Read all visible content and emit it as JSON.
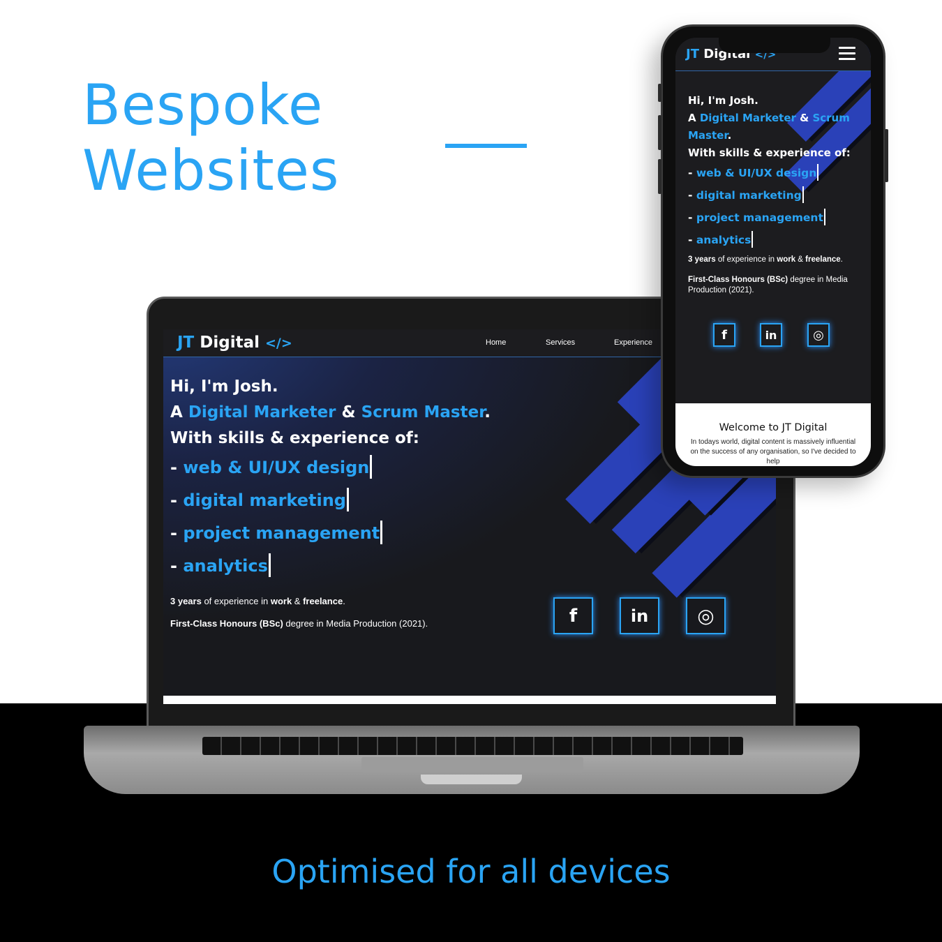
{
  "headline": {
    "line1": "Bespoke",
    "line2": "Websites"
  },
  "tagline": "Optimised for all devices",
  "colors": {
    "accent": "#2aa4f4",
    "stripe": "#2a41b8",
    "dark": "#1c1c1f"
  },
  "site": {
    "logo_prefix": "JT",
    "logo_name": "Digital",
    "logo_code": "</>",
    "nav": [
      "Home",
      "Services",
      "Experience"
    ],
    "hero": {
      "greeting": "Hi, I'm Josh.",
      "role_prefix": "A",
      "role1": "Digital Marketer",
      "role_and": "&",
      "role2": "Scrum Master",
      "role_suffix": ".",
      "skills_heading": "With skills & experience of:",
      "skills": [
        "web & UI/UX design",
        "digital marketing",
        "project management",
        "analytics"
      ]
    },
    "info1": {
      "a": "3 years",
      "b": " of experience in ",
      "c": "work",
      "d": " & ",
      "e": "freelance",
      "f": "."
    },
    "info2": {
      "a": "First-Class Honours (BSc)",
      "b": " degree in Media Production (2021)."
    },
    "social": [
      {
        "icon": "facebook-icon",
        "glyph": "f"
      },
      {
        "icon": "linkedin-icon",
        "glyph": "in"
      },
      {
        "icon": "instagram-icon",
        "glyph": "◎"
      }
    ],
    "welcome_title": "Welcome to JT Digital",
    "welcome_text": "In todays world, digital content is massively influential on the success of any organisation, so I've decided to help"
  }
}
